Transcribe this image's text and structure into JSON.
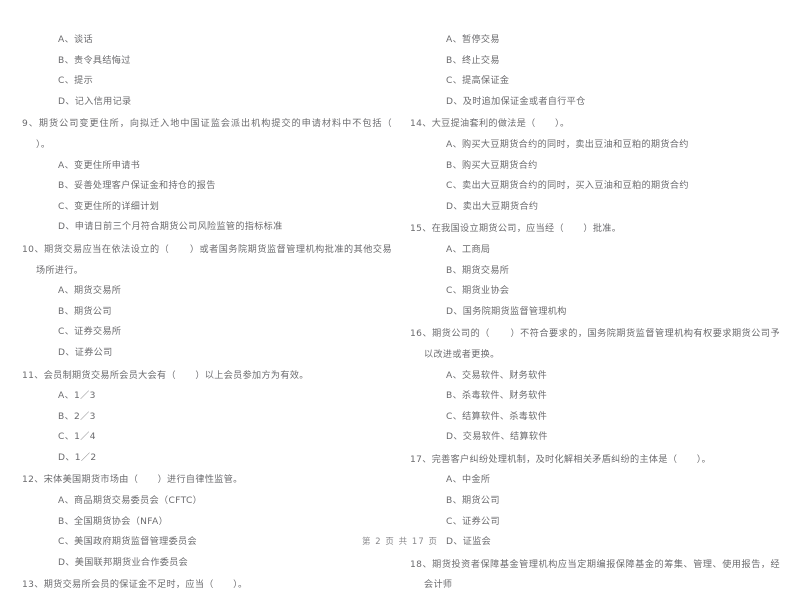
{
  "document": {
    "page_label": "第 2 页 共 17 页",
    "page_number": "2",
    "total_pages": "17",
    "text_color": "#6b6b6e"
  },
  "left_column": {
    "orphan_options": [
      "A、谈话",
      "B、责令具结悔过",
      "C、提示",
      "D、记入信用记录"
    ],
    "questions": [
      {
        "stem_number": "9、",
        "stem_text": "期货公司变更住所，向拟迁入地中国证监会派出机构提交的申请材料中不包括（      ）。",
        "options": [
          "A、变更住所申请书",
          "B、妥善处理客户保证金和持仓的报告",
          "C、变更住所的详细计划",
          "D、申请日前三个月符合期货公司风险监管的指标标准"
        ]
      },
      {
        "stem_number": "10、",
        "stem_text": "期货交易应当在依法设立的（      ）或者国务院期货监督管理机构批准的其他交易场所进行。",
        "options": [
          "A、期货交易所",
          "B、期货公司",
          "C、证券交易所",
          "D、证券公司"
        ]
      },
      {
        "stem_number": "11、",
        "stem_text": "会员制期货交易所会员大会有（      ）以上会员参加方为有效。",
        "options": [
          "A、1／3",
          "B、2／3",
          "C、1／4",
          "D、1／2"
        ]
      },
      {
        "stem_number": "12、",
        "stem_text": "宋体美国期货市场由（      ）进行自律性监管。",
        "options": [
          "A、商品期货交易委员会（CFTC）",
          "B、全国期货协会（NFA）",
          "C、美国政府期货监督管理委员会",
          "D、美国联邦期货业合作委员会"
        ]
      },
      {
        "stem_number": "13、",
        "stem_text": "期货交易所会员的保证金不足时，应当（      ）。",
        "options": []
      }
    ]
  },
  "right_column": {
    "orphan_options": [
      "A、暂停交易",
      "B、终止交易",
      "C、提高保证金",
      "D、及时追加保证金或者自行平仓"
    ],
    "questions": [
      {
        "stem_number": "14、",
        "stem_text": "大豆提油套利的做法是（      ）。",
        "options": [
          "A、购买大豆期货合约的同时，卖出豆油和豆粕的期货合约",
          "B、购买大豆期货合约",
          "C、卖出大豆期货合约的同时，买入豆油和豆粕的期货合约",
          "D、卖出大豆期货合约"
        ]
      },
      {
        "stem_number": "15、",
        "stem_text": "在我国设立期货公司，应当经（      ）批准。",
        "options": [
          "A、工商局",
          "B、期货交易所",
          "C、期货业协会",
          "D、国务院期货监督管理机构"
        ]
      },
      {
        "stem_number": "16、",
        "stem_text": "期货公司的（      ）不符合要求的，国务院期货监督管理机构有权要求期货公司予以改进或者更换。",
        "options": [
          "A、交易软件、财务软件",
          "B、杀毒软件、财务软件",
          "C、结算软件、杀毒软件",
          "D、交易软件、结算软件"
        ]
      },
      {
        "stem_number": "17、",
        "stem_text": "完善客户纠纷处理机制，及时化解相关矛盾纠纷的主体是（      ）。",
        "options": [
          "A、中金所",
          "B、期货公司",
          "C、证券公司",
          "D、证监会"
        ]
      },
      {
        "stem_number": "18、",
        "stem_text": "期货投资者保障基金管理机构应当定期编报保障基金的筹集、管理、使用报告，经会计师",
        "options": []
      }
    ]
  }
}
